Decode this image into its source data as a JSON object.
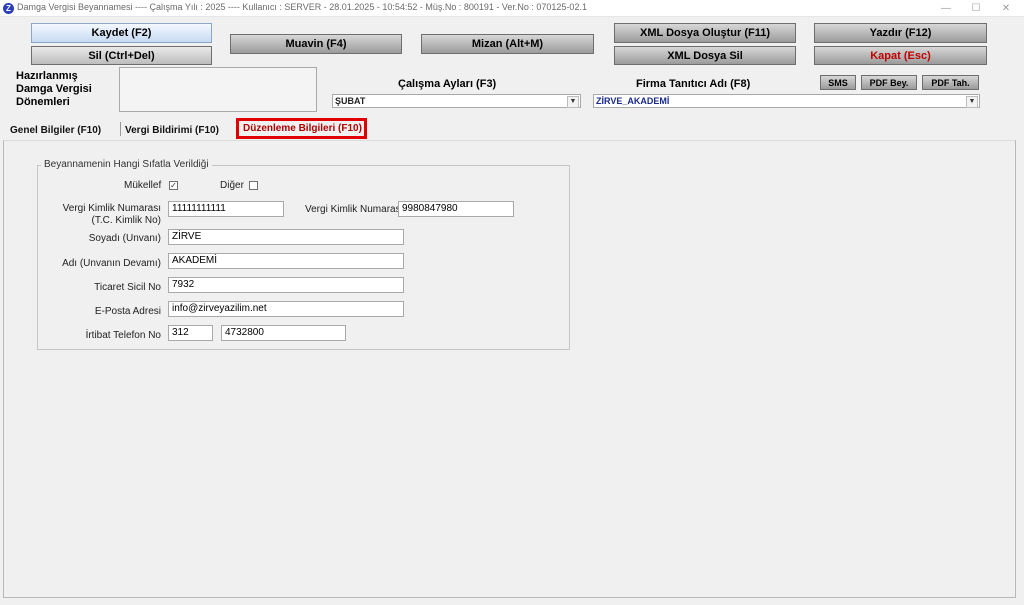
{
  "window": {
    "title": "Damga Vergisi Beyannamesi  ----  Çalışma Yılı : 2025  ----  Kullanıcı : SERVER - 28.01.2025 - 10:54:52 - Müş.No : 800191 - Ver.No : 070125-02.1",
    "minimize": "—",
    "maximize": "☐",
    "close": "✕"
  },
  "toolbar": {
    "save": "Kaydet (F2)",
    "delete": "Sil (Ctrl+Del)",
    "muavin": "Muavin (F4)",
    "mizan": "Mizan (Alt+M)",
    "xml_create": "XML Dosya Oluştur (F11)",
    "xml_delete": "XML Dosya Sil",
    "print": "Yazdır (F12)",
    "close": "Kapat (Esc)",
    "sms": "SMS",
    "pdf_bey": "PDF Bey.",
    "pdf_tah": "PDF Tah."
  },
  "prepared": {
    "label": "Hazırlanmış Damga Vergisi Dönemleri"
  },
  "work_months": {
    "label": "Çalışma Ayları (F3)",
    "value": "ŞUBAT"
  },
  "company": {
    "label": "Firma Tanıtıcı Adı (F8)",
    "value": "ZİRVE_AKADEMİ"
  },
  "tabs": {
    "general": "Genel Bilgiler (F10)",
    "tax_return": "Vergi Bildirimi (F10)",
    "arrangement": "Düzenleme Bilgileri (F10)"
  },
  "form": {
    "group_title": "Beyannamenin Hangi Sıfatla Verildiği",
    "taxpayer": {
      "label": "Mükellef",
      "checked": "✓"
    },
    "other": {
      "label": "Diğer",
      "checked": ""
    },
    "tckn": {
      "label_line1": "Vergi Kimlik Numarası",
      "label_line2": "(T.C. Kimlik No)",
      "value": "11111111111"
    },
    "vkn": {
      "label": "Vergi Kimlik Numarası",
      "value": "9980847980"
    },
    "surname": {
      "label": "Soyadı (Unvanı)",
      "value": "ZİRVE"
    },
    "name": {
      "label": "Adı (Unvanın Devamı)",
      "value": "AKADEMİ"
    },
    "trade_reg": {
      "label": "Ticaret Sicil No",
      "value": "7932"
    },
    "email": {
      "label": "E-Posta Adresi",
      "value": "info@zirveyazilim.net"
    },
    "phone": {
      "label": "İrtibat Telefon No",
      "area": "312",
      "number": "4732800"
    }
  },
  "colors": {
    "highlight": "#e00000",
    "blue_button": "#c8dbf2",
    "close_text": "#c00000"
  }
}
